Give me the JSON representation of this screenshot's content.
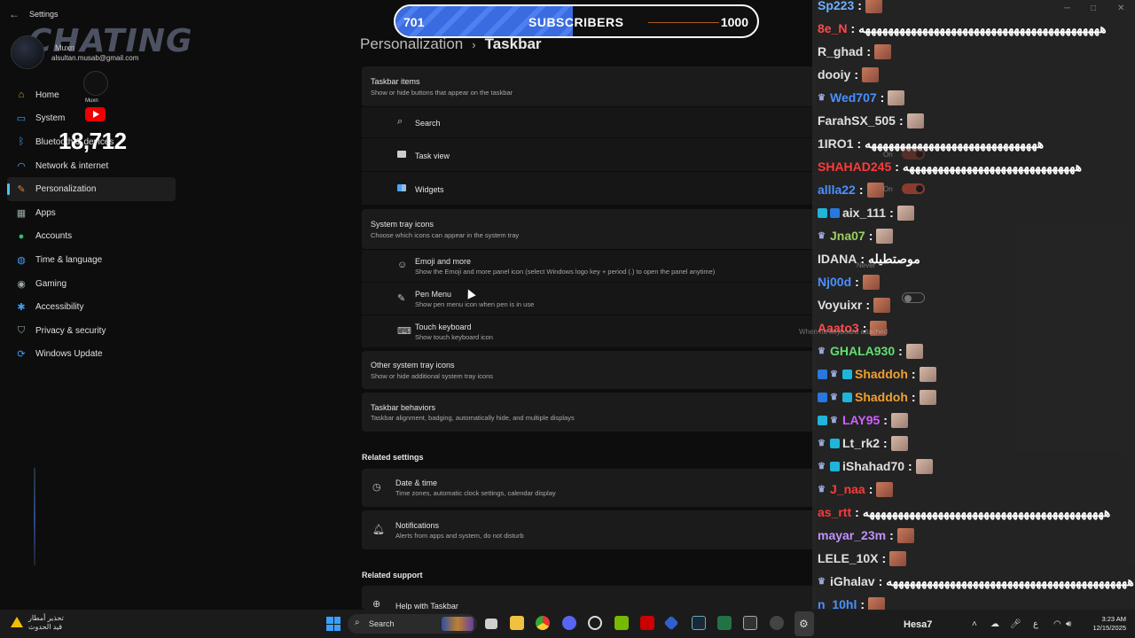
{
  "window": {
    "title": "Settings"
  },
  "overlay": {
    "logo_text": "CHATING",
    "user_name": "Muxn",
    "email": "alsultan.musab@gmail.com",
    "yt_name": "Muxn",
    "subscriber_count": "18,712",
    "subscribers_bar": {
      "current": "701",
      "label": "SUBSCRIBERS",
      "goal": "1000",
      "progress": 0.701
    }
  },
  "sidebar": {
    "items": [
      {
        "label": "Home",
        "icon": "home-icon",
        "color": "#f0a020"
      },
      {
        "label": "System",
        "icon": "monitor-icon",
        "color": "#3aa0ff"
      },
      {
        "label": "Bluetooth & devices",
        "icon": "bluetooth-icon",
        "color": "#3aa0ff"
      },
      {
        "label": "Network & internet",
        "icon": "wifi-icon",
        "color": "#5ab0ff"
      },
      {
        "label": "Personalization",
        "icon": "brush-icon",
        "color": "#e08030",
        "active": true
      },
      {
        "label": "Apps",
        "icon": "apps-icon",
        "color": "#9aa"
      },
      {
        "label": "Accounts",
        "icon": "person-icon",
        "color": "#30c070"
      },
      {
        "label": "Time & language",
        "icon": "globe-icon",
        "color": "#3aa0ff"
      },
      {
        "label": "Gaming",
        "icon": "gamepad-icon",
        "color": "#9aa"
      },
      {
        "label": "Accessibility",
        "icon": "accessibility-icon",
        "color": "#3aa0ff"
      },
      {
        "label": "Privacy & security",
        "icon": "shield-icon",
        "color": "#9aa"
      },
      {
        "label": "Windows Update",
        "icon": "update-icon",
        "color": "#3aa0ff"
      }
    ]
  },
  "weather": {
    "line1": "تحذير أمطار",
    "line2": "قيد الحدوث"
  },
  "breadcrumb": {
    "parent": "Personalization",
    "current": "Taskbar"
  },
  "taskbar_items": {
    "title": "Taskbar items",
    "subtitle": "Show or hide buttons that appear on the taskbar",
    "rows": [
      {
        "label": "Search"
      },
      {
        "label": "Task view"
      },
      {
        "label": "Widgets"
      }
    ]
  },
  "system_tray": {
    "title": "System tray icons",
    "subtitle": "Choose which icons can appear in the system tray",
    "rows": [
      {
        "label": "Emoji and more",
        "sub": "Show the Emoji and more panel icon (select Windows logo key + period (.) to open the panel anytime)"
      },
      {
        "label": "Pen Menu",
        "sub": "Show pen menu icon when pen is in use"
      },
      {
        "label": "Touch keyboard",
        "sub": "Show touch keyboard icon"
      }
    ]
  },
  "other_tray": {
    "title": "Other system tray icons",
    "subtitle": "Show or hide additional system tray icons"
  },
  "behaviors": {
    "title": "Taskbar behaviors",
    "subtitle": "Taskbar alignment, badging, automatically hide, and multiple displays"
  },
  "related_settings": {
    "heading": "Related settings",
    "items": [
      {
        "label": "Date & time",
        "sub": "Time zones, automatic clock settings, calendar display"
      },
      {
        "label": "Notifications",
        "sub": "Alerts from apps and system, do not disturb"
      }
    ]
  },
  "related_support": {
    "heading": "Related support",
    "item": "Help with Taskbar"
  },
  "settings_overlay": {
    "on1": "On",
    "on2": "On",
    "never": "Never",
    "when_no_keyboard": "When no keyboard attached"
  },
  "chat": [
    {
      "user": "Sp223",
      "color": "#6fb0ff",
      "msg": "",
      "emote": "red"
    },
    {
      "user": "8e_N",
      "color": "#ff4a4a",
      "msg": "ههههههههههههههههههههههههههههههههههههههههههه",
      "emote": ""
    },
    {
      "user": "R_ghad",
      "color": "#e0e0e0",
      "msg": "",
      "emote": "red"
    },
    {
      "user": "dooiy",
      "color": "#e0e0e0",
      "msg": "",
      "emote": "red"
    },
    {
      "user": "Wed707",
      "color": "#4a90ff",
      "msg": "",
      "emote": "pale",
      "badges": [
        "mod"
      ]
    },
    {
      "user": "FarahSX_505",
      "color": "#e0e0e0",
      "msg": "",
      "emote": "pale"
    },
    {
      "user": "1IRO1",
      "color": "#e0e0e0",
      "msg": "ههههههههههههههههههههههههههههههه",
      "emote": ""
    },
    {
      "user": "SHAHAD245",
      "color": "#ff3a3a",
      "msg": "ههههههههههههههههههههههههههههههه",
      "emote": ""
    },
    {
      "user": "allla22",
      "color": "#4a90ff",
      "msg": "",
      "emote": "red"
    },
    {
      "user": "aix_111",
      "color": "#e0e0e0",
      "msg": "",
      "emote": "pale",
      "badges": [
        "teal",
        "blue"
      ]
    },
    {
      "user": "Jna07",
      "color": "#9ad060",
      "msg": "",
      "emote": "pale",
      "badges": [
        "mod"
      ]
    },
    {
      "user": "IDANA",
      "color": "#e0e0e0",
      "msg": "موصتطيله",
      "emote": ""
    },
    {
      "user": "Nj00d",
      "color": "#4a90ff",
      "msg": "",
      "emote": "red"
    },
    {
      "user": "Voyuixr",
      "color": "#e0e0e0",
      "msg": "",
      "emote": "red"
    },
    {
      "user": "Aaato3",
      "color": "#ff4a4a",
      "msg": "",
      "emote": "red"
    },
    {
      "user": "GHALA930",
      "color": "#60e070",
      "msg": "",
      "emote": "pale",
      "badges": [
        "mod"
      ]
    },
    {
      "user": "Shaddoh",
      "color": "#f0a030",
      "msg": "",
      "emote": "pale",
      "badges": [
        "blue",
        "mod",
        "teal"
      ]
    },
    {
      "user": "Shaddoh",
      "color": "#f0a030",
      "msg": "",
      "emote": "pale",
      "badges": [
        "blue",
        "mod",
        "teal"
      ]
    },
    {
      "user": "LAY95",
      "color": "#d060ff",
      "msg": "",
      "emote": "pale",
      "badges": [
        "teal",
        "mod"
      ]
    },
    {
      "user": "Lt_rk2",
      "color": "#e0e0e0",
      "msg": "",
      "emote": "pale",
      "badges": [
        "mod",
        "teal"
      ]
    },
    {
      "user": "iShahad70",
      "color": "#e0e0e0",
      "msg": "",
      "emote": "pale",
      "badges": [
        "mod",
        "teal"
      ]
    },
    {
      "user": "J_naa",
      "color": "#ff3a3a",
      "msg": "",
      "emote": "red",
      "badges": [
        "mod"
      ]
    },
    {
      "user": "as_rtt",
      "color": "#ff3a3a",
      "msg": "ههههههههههههههههههههههههههههههههههههههههههه",
      "emote": ""
    },
    {
      "user": "mayar_23m",
      "color": "#c090ff",
      "msg": "",
      "emote": "red"
    },
    {
      "user": "LELE_10X",
      "color": "#e0e0e0",
      "msg": "",
      "emote": "red"
    },
    {
      "user": "iGhalav",
      "color": "#e0e0e0",
      "msg": "ههههههههههههههههههههههههههههههههههههههههههه",
      "emote": "",
      "badges": [
        "mod"
      ]
    },
    {
      "user": "n_10hl",
      "color": "#4a90ff",
      "msg": "",
      "emote": "red"
    }
  ],
  "taskbar": {
    "search": "Search",
    "user": "Hesa7",
    "lang": "ع",
    "time": "3:23 AM",
    "date": "12/15/2025"
  }
}
